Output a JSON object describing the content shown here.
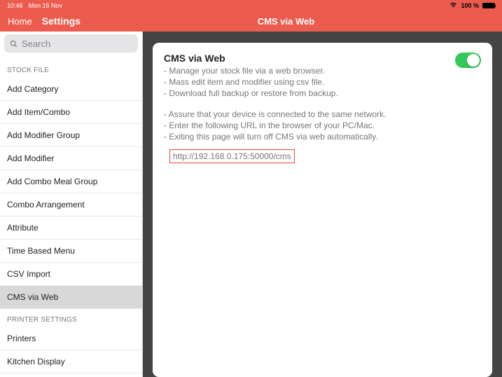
{
  "status": {
    "time": "10:46",
    "date": "Mon 16 Nov",
    "battery": "100 %"
  },
  "nav": {
    "home": "Home",
    "settings": "Settings",
    "title": "CMS via Web"
  },
  "search": {
    "placeholder": "Search"
  },
  "sidebar": {
    "section1": "STOCK FILE",
    "items1": [
      "Add Category",
      "Add Item/Combo",
      "Add Modifier Group",
      "Add Modifier",
      "Add Combo Meal Group",
      "Combo Arrangement",
      "Attribute",
      "Time Based Menu",
      "CSV Import",
      "CMS via Web"
    ],
    "section2": "PRINTER SETTINGS",
    "items2": [
      "Printers",
      "Kitchen Display"
    ]
  },
  "card": {
    "title": "CMS via Web",
    "d1": "- Manage your stock file via a web browser.",
    "d2": "- Mass edit item and modifier using csv file.",
    "d3": "- Download full backup or restore from backup.",
    "d4": "- Assure that your device is connected to the same network.",
    "d5": "- Enter the following URL in the browser of your PC/Mac.",
    "d6": "- Exiting this page will turn off CMS via web automatically.",
    "url": "http://192.168.0.175:50000/cms"
  }
}
